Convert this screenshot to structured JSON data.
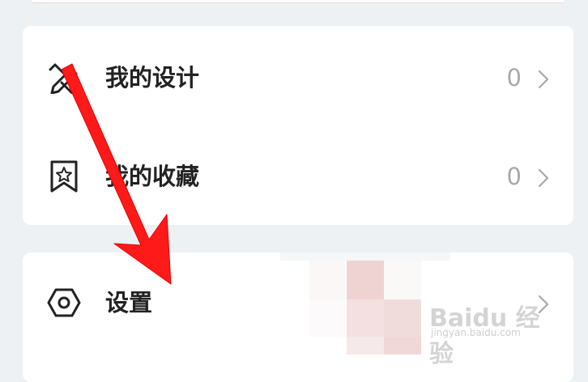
{
  "menu": {
    "items": [
      {
        "label": "我的设计",
        "count": "0",
        "icon": "pencil-ruler-icon"
      },
      {
        "label": "我的收藏",
        "count": "0",
        "icon": "bookmark-star-icon"
      }
    ]
  },
  "settings": {
    "label": "设置",
    "icon": "hexagon-gear-icon"
  },
  "watermark": {
    "brand": "Baidu 经验",
    "url": "jingyan.baidu.com"
  },
  "colors": {
    "accent_arrow": "#ff1a1a",
    "text": "#222222",
    "muted": "#a9a9a9",
    "background": "#edf1f4"
  }
}
